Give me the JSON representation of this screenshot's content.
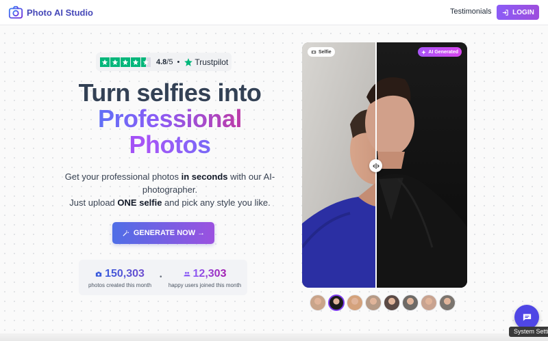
{
  "header": {
    "brand": "Photo AI Studio",
    "nav_testimonials": "Testimonials",
    "login_label": "LOGIN"
  },
  "trustpilot": {
    "rating": "4.8",
    "rating_denominator": "/5",
    "separator": "•",
    "brand": "Trustpilot",
    "stars": 4.5
  },
  "hero": {
    "line1": "Turn selfies into",
    "line2": "Professional",
    "line3": "Photos",
    "sub_p1": "Get your professional photos ",
    "sub_b1": "in seconds",
    "sub_p2": " with our AI-photographer.",
    "sub_p3": "Just upload ",
    "sub_b2": "ONE selfie",
    "sub_p4": " and pick any style you like.",
    "cta_label": "GENERATE NOW →"
  },
  "stats": {
    "photos_count": "150,303",
    "photos_label": "photos created this month",
    "separator": "•",
    "users_count": "12,303",
    "users_label": "happy users joined this month"
  },
  "comparison": {
    "left_badge": "Selfie",
    "right_badge": "AI Generated",
    "split_position": 0.45
  },
  "thumbnails": [
    {
      "name": "style-1",
      "color": "#c9a48a"
    },
    {
      "name": "style-2",
      "color": "#1a1a1a",
      "active": true
    },
    {
      "name": "style-3",
      "color": "#d4a27c"
    },
    {
      "name": "style-4",
      "color": "#b59a86"
    },
    {
      "name": "style-5",
      "color": "#5b4a45"
    },
    {
      "name": "style-6",
      "color": "#6e6a66"
    },
    {
      "name": "style-7",
      "color": "#c8a390"
    },
    {
      "name": "style-8",
      "color": "#7a746e"
    }
  ],
  "chat": {
    "tooltip": "System Settings"
  },
  "colors": {
    "accent": "#7c3aed",
    "brand_text": "#4648b8",
    "trustpilot_green": "#00b67a",
    "chat_blue": "#4f46e5"
  }
}
